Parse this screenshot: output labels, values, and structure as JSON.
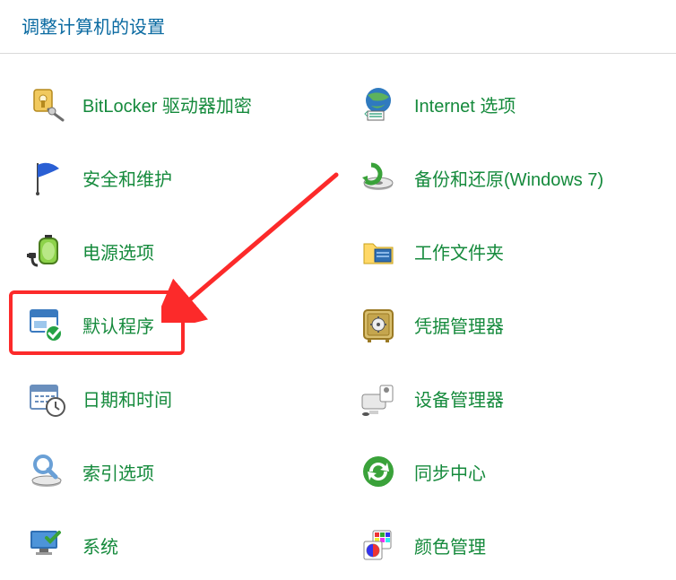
{
  "header": {
    "title": "调整计算机的设置"
  },
  "items": {
    "left": [
      {
        "name": "bitlocker",
        "label": "BitLocker 驱动器加密"
      },
      {
        "name": "security",
        "label": "安全和维护"
      },
      {
        "name": "power",
        "label": "电源选项"
      },
      {
        "name": "default-apps",
        "label": "默认程序"
      },
      {
        "name": "datetime",
        "label": "日期和时间"
      },
      {
        "name": "indexing",
        "label": "索引选项"
      },
      {
        "name": "system",
        "label": "系统"
      }
    ],
    "right": [
      {
        "name": "internet",
        "label": "Internet 选项"
      },
      {
        "name": "backup",
        "label": "备份和还原(Windows 7)"
      },
      {
        "name": "workfolders",
        "label": "工作文件夹"
      },
      {
        "name": "credentials",
        "label": "凭据管理器"
      },
      {
        "name": "devicemgr",
        "label": "设备管理器"
      },
      {
        "name": "sync",
        "label": "同步中心"
      },
      {
        "name": "color",
        "label": "颜色管理"
      }
    ]
  }
}
